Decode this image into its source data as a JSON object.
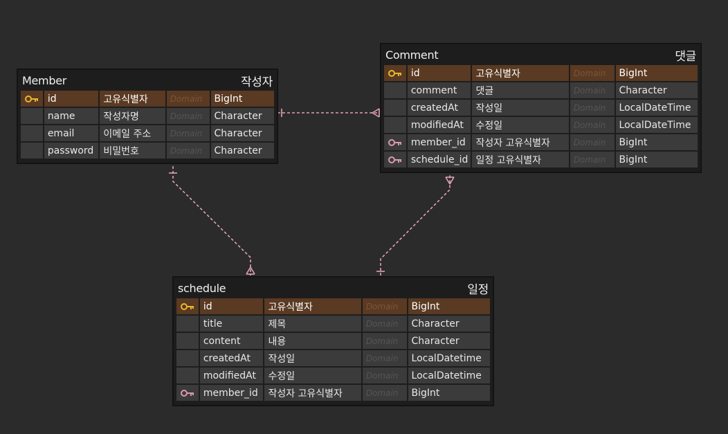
{
  "colors": {
    "background": "#2b2b2b",
    "entity_bg": "#1d1d1d",
    "row_bg": "#3b3b3b",
    "pk_row_bg": "#5a3a22",
    "pk_key": "#e8b830",
    "fk_key": "#d89ab0",
    "relation_line": "#e3a2b5"
  },
  "entities": {
    "member": {
      "name": "Member",
      "alias": "작성자",
      "columns": [
        {
          "key": "pk",
          "name": "id",
          "label": "고유식별자",
          "domain": "Domain",
          "type": "BigInt"
        },
        {
          "key": "",
          "name": "name",
          "label": "작성자명",
          "domain": "Domain",
          "type": "Character"
        },
        {
          "key": "",
          "name": "email",
          "label": "이메일 주소",
          "domain": "Domain",
          "type": "Character"
        },
        {
          "key": "",
          "name": "password",
          "label": "비밀번호",
          "domain": "Domain",
          "type": "Character"
        }
      ]
    },
    "comment": {
      "name": "Comment",
      "alias": "댓글",
      "columns": [
        {
          "key": "pk",
          "name": "id",
          "label": "고유식별자",
          "domain": "Domain",
          "type": "BigInt"
        },
        {
          "key": "",
          "name": "comment",
          "label": "댓글",
          "domain": "Domain",
          "type": "Character"
        },
        {
          "key": "",
          "name": "createdAt",
          "label": "작성일",
          "domain": "Domain",
          "type": "LocalDateTime"
        },
        {
          "key": "",
          "name": "modifiedAt",
          "label": "수정일",
          "domain": "Domain",
          "type": "LocalDateTime"
        },
        {
          "key": "fk",
          "name": "member_id",
          "label": "작성자 고유식별자",
          "domain": "Domain",
          "type": "BigInt"
        },
        {
          "key": "fk",
          "name": "schedule_id",
          "label": "일정 고유식별자",
          "domain": "Domain",
          "type": "BigInt"
        }
      ]
    },
    "schedule": {
      "name": "schedule",
      "alias": "일정",
      "columns": [
        {
          "key": "pk",
          "name": "id",
          "label": "고유식별자",
          "domain": "Domain",
          "type": "BigInt"
        },
        {
          "key": "",
          "name": "title",
          "label": "제목",
          "domain": "Domain",
          "type": "Character"
        },
        {
          "key": "",
          "name": "content",
          "label": "내용",
          "domain": "Domain",
          "type": "Character"
        },
        {
          "key": "",
          "name": "createdAt",
          "label": "작성일",
          "domain": "Domain",
          "type": "LocalDatetime"
        },
        {
          "key": "",
          "name": "modifiedAt",
          "label": "수정일",
          "domain": "Domain",
          "type": "LocalDatetime"
        },
        {
          "key": "fk",
          "name": "member_id",
          "label": "작성자 고유식별자",
          "domain": "Domain",
          "type": "BigInt"
        }
      ]
    }
  },
  "relations": [
    {
      "from": "member",
      "to": "comment",
      "from_end": "one",
      "to_end": "many"
    },
    {
      "from": "member",
      "to": "schedule",
      "from_end": "one",
      "to_end": "many"
    },
    {
      "from": "schedule",
      "to": "comment",
      "from_end": "one",
      "to_end": "many"
    }
  ]
}
